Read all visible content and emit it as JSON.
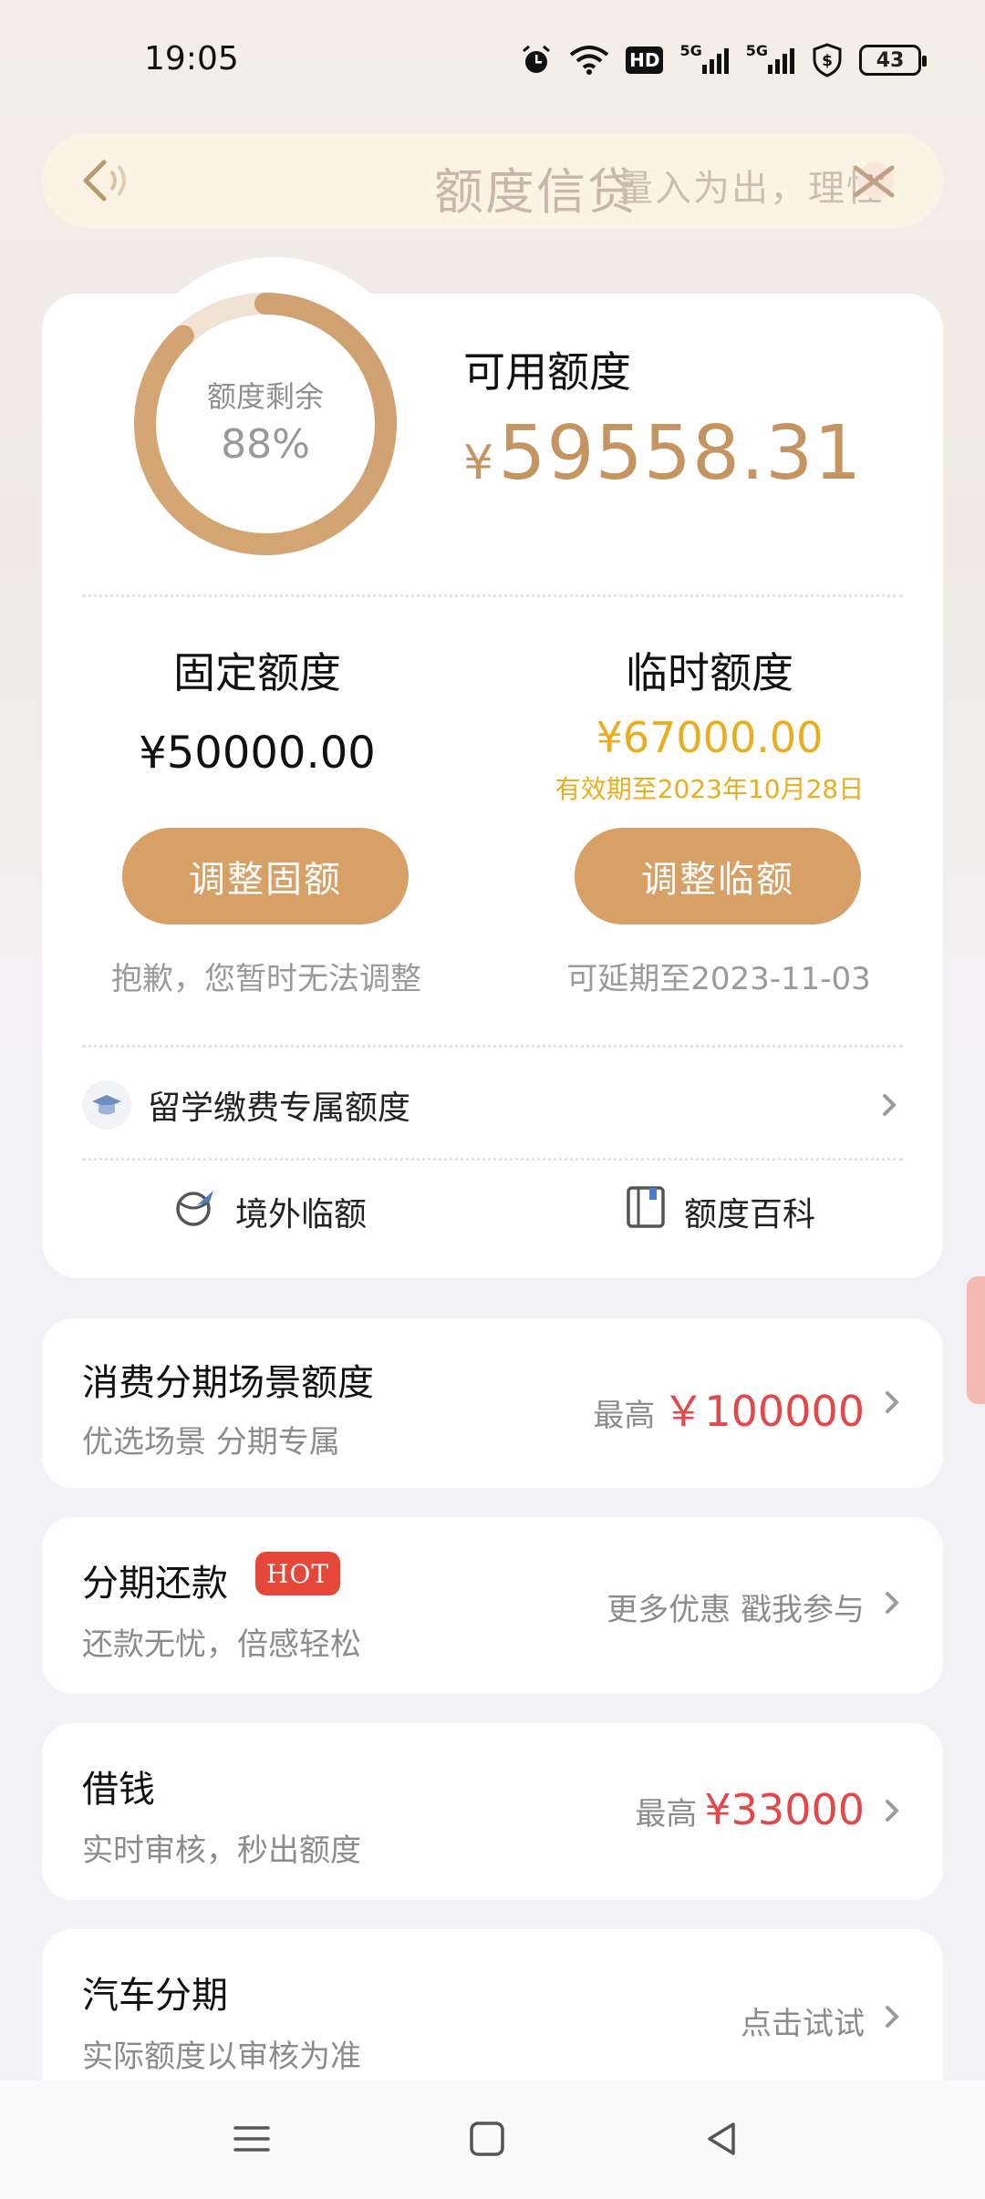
{
  "status_bar": {
    "time": "19:05",
    "hd_label": "HD",
    "signal1_label": "5G",
    "signal2_label": "5G",
    "battery": "43"
  },
  "header": {
    "title": "额度信贷",
    "slogan": "量入为出，理性",
    "back_icon": "speaker-back-icon",
    "close_icon": "close-mascot-icon"
  },
  "credit": {
    "remaining_label": "额度剩余",
    "remaining_pct": "88%",
    "remaining_fraction": 0.88,
    "available_label": "可用额度",
    "available_currency": "¥",
    "available_amount": "59558.31",
    "fixed": {
      "title": "固定额度",
      "amount": "¥50000.00",
      "button": "调整固额",
      "note": "抱歉，您暂时无法调整"
    },
    "temporary": {
      "title": "临时额度",
      "amount": "¥67000.00",
      "valid_until": "有效期至2023年10月28日",
      "button": "调整临额",
      "note": "可延期至2023-11-03"
    },
    "study_abroad": "留学缴费专属额度",
    "overseas": "境外临额",
    "encyclopedia": "额度百科"
  },
  "cards": [
    {
      "title": "消费分期场景额度",
      "subtitle": "优选场景 分期专属",
      "right_prefix": "最高",
      "right_value": "￥100000"
    },
    {
      "title": "分期还款",
      "badge": "HOT",
      "subtitle": "还款无忧，倍感轻松",
      "right_text": "更多优惠 戳我参与"
    },
    {
      "title": "借钱",
      "subtitle": "实时审核，秒出额度",
      "right_prefix": "最高",
      "right_value": "¥33000"
    },
    {
      "title": "汽车分期",
      "subtitle": "实际额度以审核为准",
      "right_text": "点击试试"
    }
  ],
  "colors": {
    "gold": "#c49461",
    "button": "#d6a066",
    "temp_yellow": "#e8ae1f",
    "red": "#e2474a",
    "hot": "#e5483b"
  }
}
